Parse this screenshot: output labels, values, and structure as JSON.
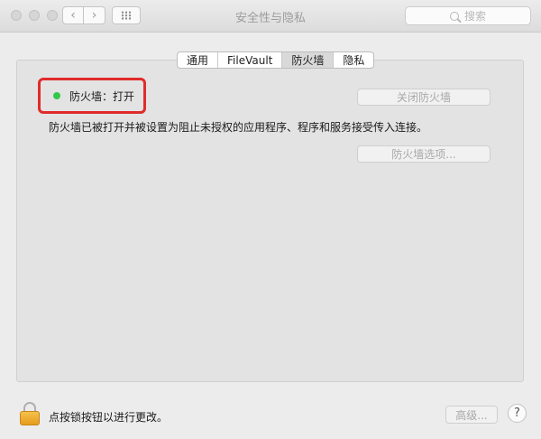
{
  "window": {
    "title": "安全性与隐私"
  },
  "toolbar": {
    "back_icon": "‹",
    "forward_icon": "›"
  },
  "search": {
    "placeholder": "搜索"
  },
  "tabs": [
    {
      "label": "通用",
      "active": false
    },
    {
      "label": "FileVault",
      "active": false
    },
    {
      "label": "防火墙",
      "active": true
    },
    {
      "label": "隐私",
      "active": false
    }
  ],
  "firewall": {
    "status": "防火墙：打开",
    "description": "防火墙已被打开并被设置为阻止未授权的应用程序、程序和服务接受传入连接。",
    "turn_off_button": "关闭防火墙",
    "options_button": "防火墙选项..."
  },
  "bottom": {
    "lock_text": "点按锁按钮以进行更改。",
    "advanced_button": "高级...",
    "help_button": "?"
  },
  "colors": {
    "highlight": "#e02b2b",
    "status_on": "#34c84a",
    "lock": "#f0b02f"
  }
}
